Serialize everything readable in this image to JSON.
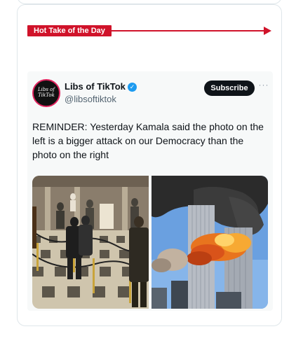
{
  "banner": {
    "label": "Hot Take of the Day",
    "color": "#d0132a"
  },
  "tweet": {
    "author": {
      "name": "Libs of TikTok",
      "handle": "@libsoftiktok",
      "verified": true,
      "avatar_text": "Libs of TikTok"
    },
    "subscribe_label": "Subscribe",
    "more_icon": "ellipsis-icon",
    "text": "REMINDER: Yesterday Kamala said the photo on the left is a bigger attack on our Democracy than the photo on the right",
    "media": [
      {
        "name": "capitol-statuary-hall-photo"
      },
      {
        "name": "world-trade-center-attack-photo"
      }
    ]
  }
}
